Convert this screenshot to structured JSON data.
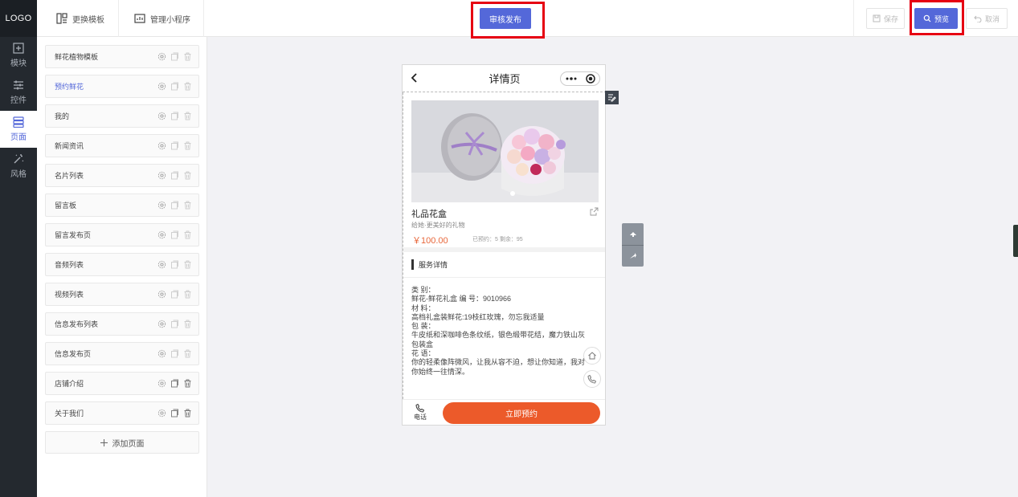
{
  "rail": {
    "logo": "LOGO",
    "items": [
      {
        "label": "模块",
        "icon": "add-box-icon"
      },
      {
        "label": "控件",
        "icon": "sliders-icon"
      },
      {
        "label": "页面",
        "icon": "pages-icon",
        "active": true
      },
      {
        "label": "风格",
        "icon": "magic-wand-icon"
      }
    ]
  },
  "topbar": {
    "template_label": "更换模板",
    "manage_label": "管理小程序",
    "publish_label": "审核发布",
    "save_label": "保存",
    "preview_label": "预览",
    "cancel_label": "取消"
  },
  "pages": [
    {
      "label": "鲜花植物模板"
    },
    {
      "label": "预约鲜花",
      "active": true
    },
    {
      "label": "我的"
    },
    {
      "label": "新闻资讯"
    },
    {
      "label": "名片列表"
    },
    {
      "label": "留言板"
    },
    {
      "label": "留言发布页"
    },
    {
      "label": "音频列表"
    },
    {
      "label": "视频列表"
    },
    {
      "label": "信息发布列表"
    },
    {
      "label": "信息发布页"
    },
    {
      "label": "店铺介绍"
    },
    {
      "label": "关于我们"
    }
  ],
  "add_page_label": "添加页面",
  "phone": {
    "title": "详情页",
    "product_title": "礼品花盒",
    "product_subtitle": "给她·更美好的礼物",
    "price": "￥100.00",
    "meta": "已预约：5  剩余：95",
    "section_title": "服务详情",
    "description": [
      "类 别：",
      "鲜花-鲜花礼盒 编 号：9010966",
      "材 料：",
      "高档礼盒装鲜花:19枝红玫瑰，勿忘我适量",
      "包 装：",
      "牛皮纸和深咖啡色条纹纸，银色缎带花结，魔力铁山灰",
      "包装盒",
      "花 语：",
      "你的轻柔像阵微风，让我从容不迫，想让你知道，我对",
      "你始终一往情深。"
    ],
    "call_label": "电话",
    "book_label": "立即预约"
  },
  "colors": {
    "accent": "#5468d9",
    "highlight_box": "#e60012",
    "cta": "#ec5a2a"
  }
}
